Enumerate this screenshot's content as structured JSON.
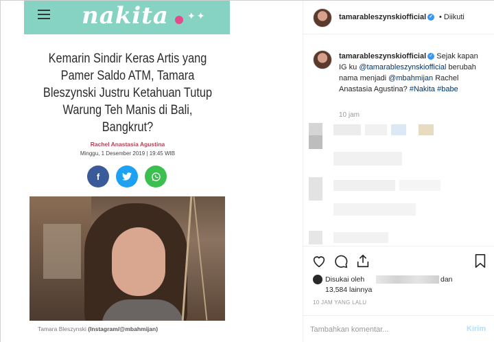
{
  "article": {
    "site_logo": "nakita",
    "headline": "Kemarin Sindir Keras Artis yang Pamer Saldo ATM, Tamara Bleszynski Justru Ketahuan Tutup Warung Teh Manis di Bali, Bangkrut?",
    "author": "Rachel Anastasia Agustina",
    "date": "Minggu, 1 Desember 2019 | 19:45 WIB",
    "share_buttons": [
      {
        "icon": "facebook-icon",
        "label": "f",
        "color": "#3b5a9a"
      },
      {
        "icon": "twitter-icon",
        "label": "🐦",
        "color": "#1da1f2"
      },
      {
        "icon": "whatsapp-icon",
        "label": "✆",
        "color": "#3bbf4f"
      }
    ],
    "caption_name": "Tamara Bleszynski",
    "caption_source": "(Instagram/@mbahmijan)"
  },
  "instagram": {
    "header": {
      "username": "tamarableszynskiofficial",
      "separator": "•",
      "follow_label": "Diikuti"
    },
    "comment": {
      "username": "tamarableszynskiofficial",
      "text_1": "Sejak kapan IG ku",
      "mention_1": "@tamarableszynskiofficial",
      "text_2": "berubah nama menjadi",
      "mention_2": "@mbahmijan",
      "text_3": "Rachel Anastasia Agustina?",
      "hashtag_1": "#Nakita",
      "hashtag_2": "#babe",
      "time": "10 jam"
    },
    "likes": {
      "liked_by": "Disukai oleh",
      "and": "dan",
      "count": "13,584 lainnya"
    },
    "posted_ago": "10 JAM YANG LALU",
    "add_comment_placeholder": "Tambahkan komentar...",
    "post_label": "Kirim"
  },
  "colors": {
    "nakita_bar": "#86d3c3",
    "author": "#c23a53",
    "instagram_link": "#003569",
    "verified": "#3897f0"
  }
}
